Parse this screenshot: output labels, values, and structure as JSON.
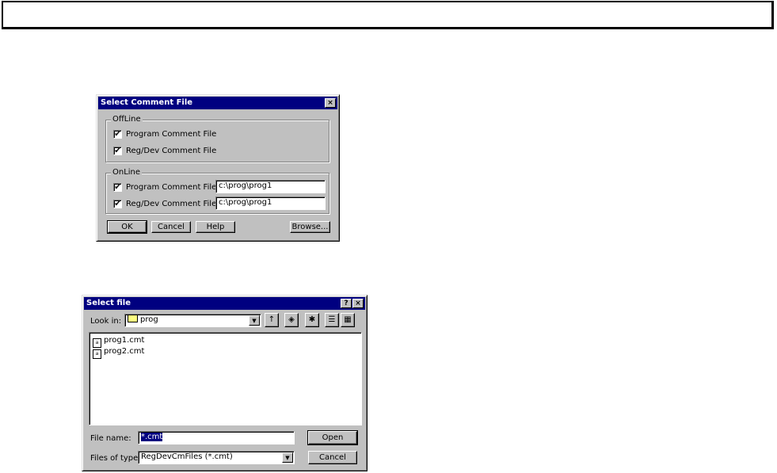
{
  "dialog1": {
    "title": "Select Comment File",
    "close_glyph": "×",
    "offline": {
      "legend": "OffLine",
      "program_checked": "✔",
      "program_label": "Program Comment File",
      "regdev_checked": "✔",
      "regdev_label": "Reg/Dev Comment File"
    },
    "online": {
      "legend": "OnLine",
      "program_checked": "✔",
      "program_label": "Program Comment File",
      "program_value": "c:\\prog\\prog1",
      "regdev_checked": "✔",
      "regdev_label": "Reg/Dev Comment File",
      "regdev_value": "c:\\prog\\prog1"
    },
    "buttons": {
      "ok": "OK",
      "cancel": "Cancel",
      "help": "Help",
      "browse": "Browse..."
    }
  },
  "dialog2": {
    "title": "Select file",
    "help_glyph": "?",
    "close_glyph": "×",
    "look_in_label": "Look in:",
    "look_in_value": "prog",
    "toolbar_icons": [
      "up-folder-icon",
      "desktop-icon",
      "new-folder-icon",
      "list-view-icon",
      "details-view-icon"
    ],
    "files": [
      "prog1.cmt",
      "prog2.cmt"
    ],
    "file_name_label": "File name:",
    "file_name_value": "*.cmt",
    "file_type_label": "Files of type:",
    "file_type_value": "RegDevCmFiles (*.cmt)",
    "open_label": "Open",
    "cancel_label": "Cancel"
  }
}
